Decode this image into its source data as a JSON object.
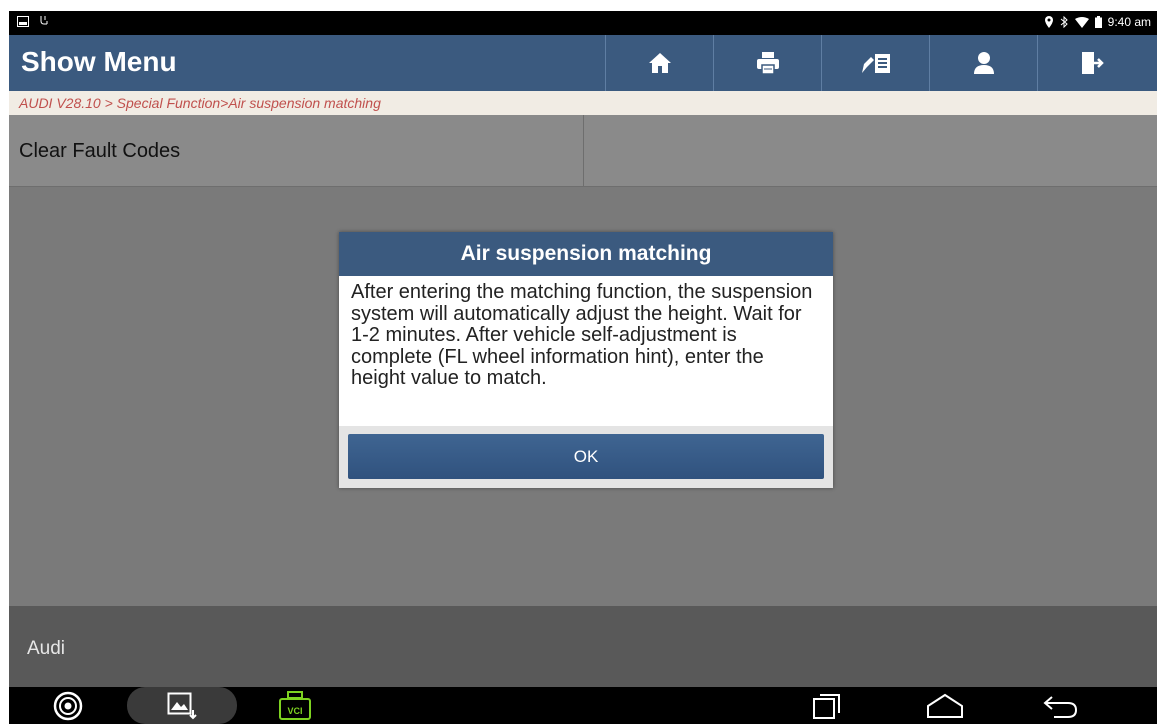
{
  "status_bar": {
    "time": "9:40 am"
  },
  "header": {
    "title": "Show Menu",
    "tools": [
      "home-icon",
      "printer-icon",
      "report-icon",
      "user-icon",
      "exit-icon"
    ]
  },
  "breadcrumb": "AUDI V28.10 > Special Function>Air suspension matching",
  "menu": {
    "items": [
      {
        "label": "Clear Fault Codes"
      }
    ]
  },
  "footer": {
    "label": "Audi"
  },
  "nav": {
    "vci_label": "VCI"
  },
  "dialog": {
    "title": "Air suspension matching",
    "message": "After entering the matching function, the suspension system will automatically adjust the height. Wait for 1-2 minutes. After vehicle self-adjustment is complete (FL wheel information hint), enter the height value to match.",
    "ok_label": "OK"
  },
  "colors": {
    "header": "#3b5a7f",
    "breadcrumb_text": "#c0504d",
    "overlay": "#7a7a7a"
  }
}
